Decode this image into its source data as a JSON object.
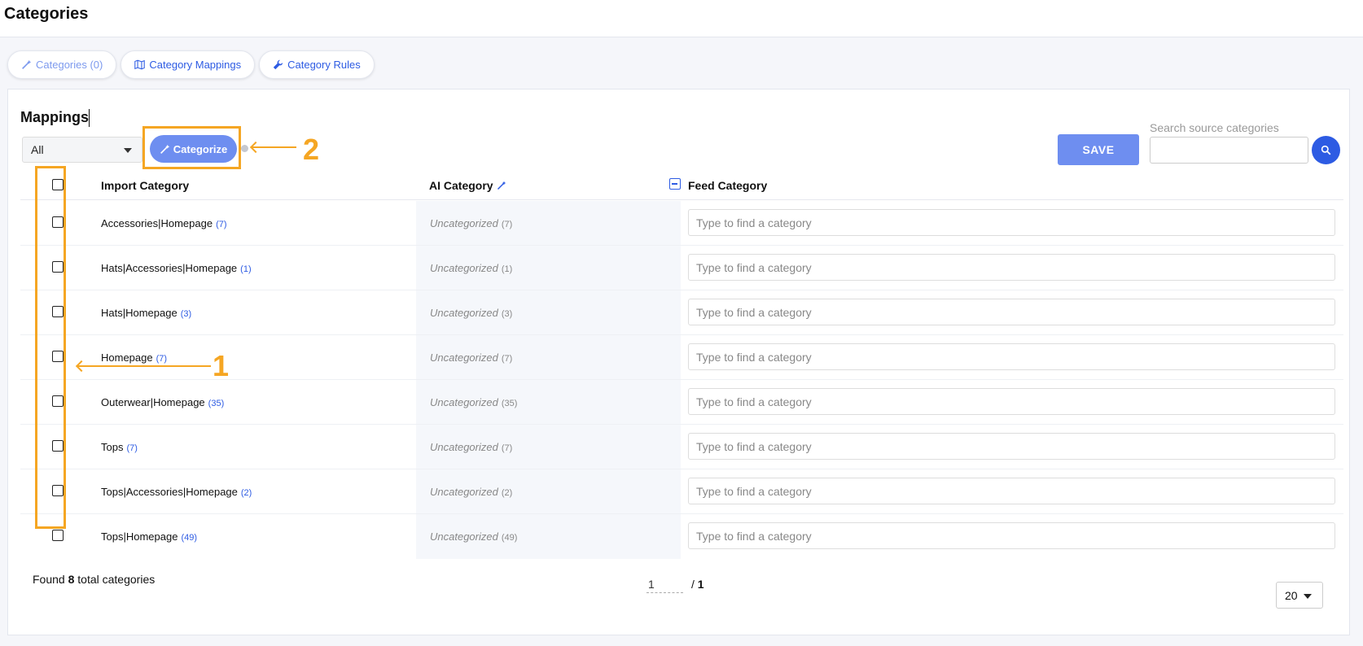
{
  "header": {
    "title": "Categories"
  },
  "tabs": [
    {
      "label": "Categories (0)",
      "icon": "magic-wand-icon"
    },
    {
      "label": "Category Mappings",
      "icon": "map-icon"
    },
    {
      "label": "Category Rules",
      "icon": "wrench-icon"
    }
  ],
  "mappings": {
    "title": "Mappings",
    "filter": {
      "selected": "All"
    },
    "categorize_label": "Categorize",
    "save_label": "SAVE",
    "search": {
      "label": "Search source categories",
      "value": ""
    }
  },
  "table": {
    "columns": {
      "import": "Import Category",
      "ai": "AI Category",
      "feed": "Feed Category"
    },
    "feed_placeholder": "Type to find a category",
    "rows": [
      {
        "import": "Accessories|Homepage",
        "import_count": "(7)",
        "ai": "Uncategorized",
        "ai_count": "(7)"
      },
      {
        "import": "Hats|Accessories|Homepage",
        "import_count": "(1)",
        "ai": "Uncategorized",
        "ai_count": "(1)"
      },
      {
        "import": "Hats|Homepage",
        "import_count": "(3)",
        "ai": "Uncategorized",
        "ai_count": "(3)"
      },
      {
        "import": "Homepage",
        "import_count": "(7)",
        "ai": "Uncategorized",
        "ai_count": "(7)"
      },
      {
        "import": "Outerwear|Homepage",
        "import_count": "(35)",
        "ai": "Uncategorized",
        "ai_count": "(35)"
      },
      {
        "import": "Tops",
        "import_count": "(7)",
        "ai": "Uncategorized",
        "ai_count": "(7)"
      },
      {
        "import": "Tops|Accessories|Homepage",
        "import_count": "(2)",
        "ai": "Uncategorized",
        "ai_count": "(2)"
      },
      {
        "import": "Tops|Homepage",
        "import_count": "(49)",
        "ai": "Uncategorized",
        "ai_count": "(49)"
      }
    ]
  },
  "footer": {
    "found_prefix": "Found",
    "found_count": "8",
    "found_suffix": "total categories",
    "page_current": "1",
    "page_sep": "/",
    "page_total": "1",
    "per_page": "20"
  },
  "annotations": {
    "marker_1": "1",
    "marker_2": "2",
    "color": "#f5a623"
  },
  "colors": {
    "accent": "#2d5be3",
    "button": "#6e8ef0"
  }
}
